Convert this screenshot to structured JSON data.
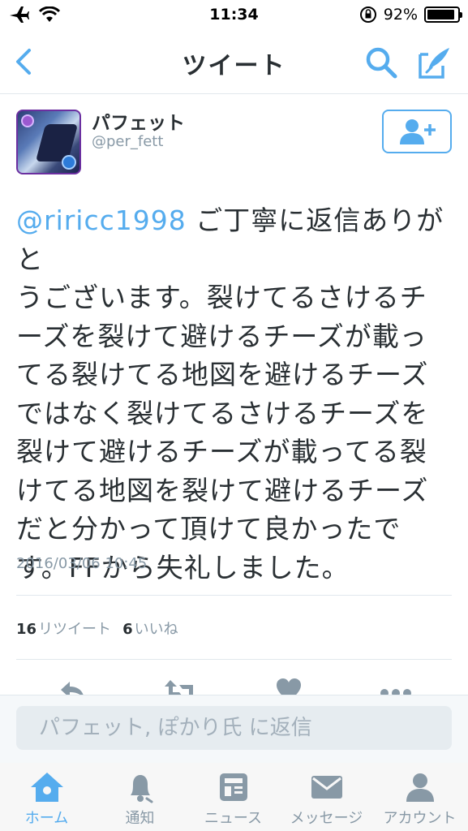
{
  "status_bar": {
    "time": "11:34",
    "battery_percent": "92%",
    "battery_level": 0.92
  },
  "nav": {
    "title": "ツイート",
    "back_icon": "chevron-left-icon",
    "search_icon": "search-icon",
    "compose_icon": "compose-tweet-icon"
  },
  "tweet": {
    "display_name": "パフェット",
    "screen_name": "@per_fett",
    "mention": "@riricc1998",
    "lines": [
      " ご丁寧に返信ありがと",
      "うございます。裂けてるさけるチ",
      "ーズを裂けて避けるチーズが載っ",
      "てる裂けてる地図を避けるチーズ",
      "ではなく裂けてるさけるチーズを",
      "裂けて避けるチーズが載ってる裂",
      "けてる地図を裂けて避けるチーズ",
      "だと分かって頂けて良かったで",
      "す。FFから失礼しました。"
    ],
    "timestamp": "2016/03/06 10:45",
    "retweet_count": "16",
    "retweet_label": "リツイート",
    "like_count": "6",
    "like_label": "いいね"
  },
  "reply": {
    "placeholder": "パフェット, ぽかり氏 に返信"
  },
  "tabs": [
    {
      "label": "ホーム",
      "icon": "home-icon",
      "active": true
    },
    {
      "label": "通知",
      "icon": "bell-icon",
      "active": false
    },
    {
      "label": "ニュース",
      "icon": "news-icon",
      "active": false
    },
    {
      "label": "メッセージ",
      "icon": "envelope-icon",
      "active": false
    },
    {
      "label": "アカウント",
      "icon": "person-icon",
      "active": false
    }
  ],
  "colors": {
    "accent": "#55acee",
    "muted": "#8899a6",
    "text": "#292f33"
  }
}
